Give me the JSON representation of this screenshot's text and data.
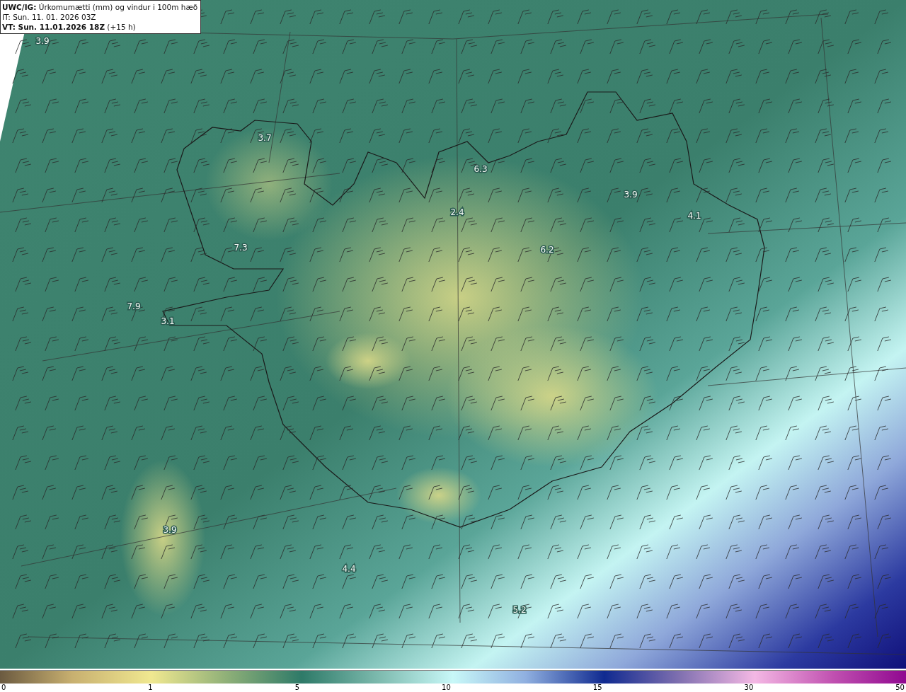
{
  "header": {
    "lines": [
      "**UWC/IG:** Úrkomumætti (mm) og vindur i 100m hæð",
      "IT: Sun. 11. 01. 2026 03Z",
      "**VT: Sun. 11.01.2026 18Z** (+15 h)"
    ]
  },
  "map": {
    "value_labels": [
      "3.9",
      "3.7",
      "6.3",
      "2.4",
      "3.9",
      "4.1",
      "6.2",
      "7.3",
      "7.9",
      "3.1",
      "3.9",
      "4.4",
      "5.2"
    ]
  },
  "colorbar": {
    "ticks": [
      "0",
      "1",
      "5",
      "10",
      "15",
      "30",
      "50"
    ]
  }
}
